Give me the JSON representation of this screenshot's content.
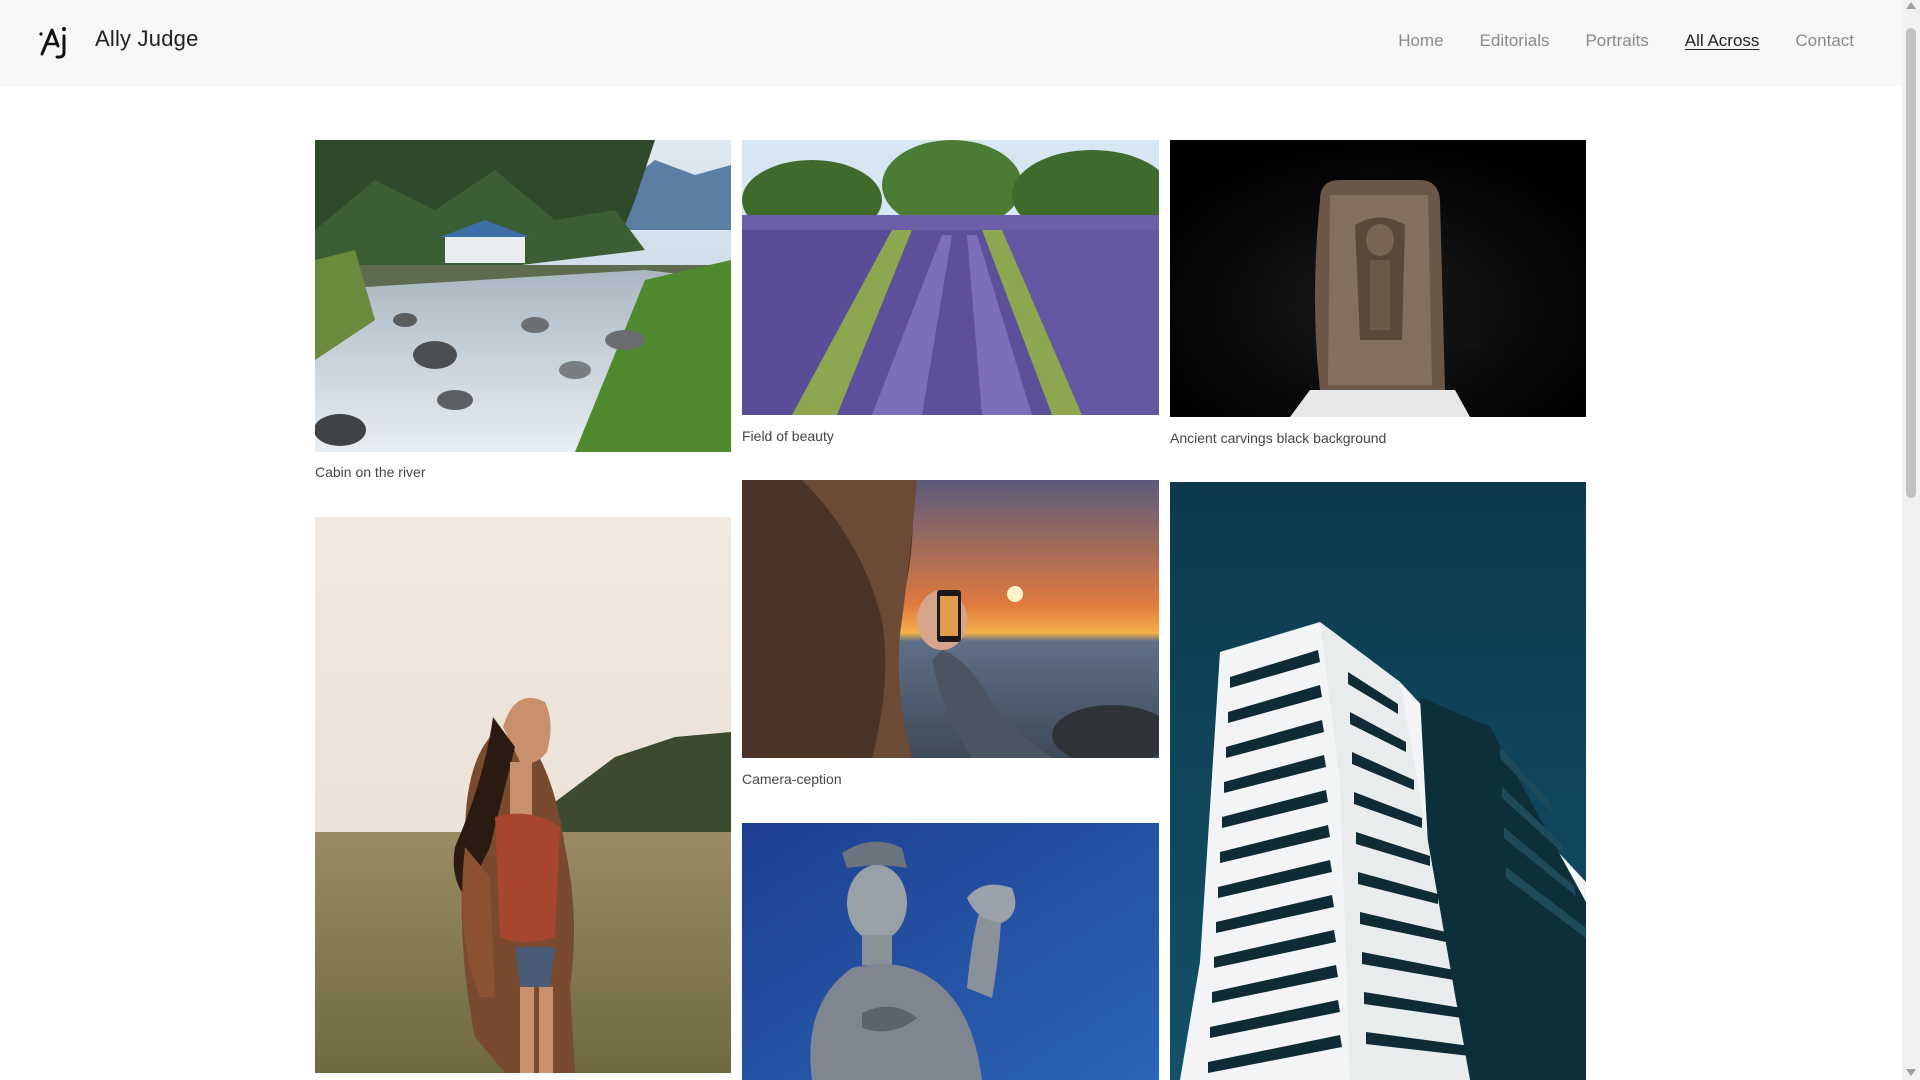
{
  "site": {
    "name": "Ally Judge",
    "logo_icon": "aj-monogram-icon"
  },
  "nav": {
    "items": [
      {
        "label": "Home",
        "active": false
      },
      {
        "label": "Editorials",
        "active": false
      },
      {
        "label": "Portraits",
        "active": false
      },
      {
        "label": "All Across",
        "active": true
      },
      {
        "label": "Contact",
        "active": false
      }
    ]
  },
  "gallery": {
    "items": [
      {
        "caption": "Cabin on the river"
      },
      {
        "caption": "Field of beauty"
      },
      {
        "caption": "Ancient carvings black background"
      },
      {
        "caption": ""
      },
      {
        "caption": "Camera-ception"
      },
      {
        "caption": ""
      },
      {
        "caption": ""
      }
    ]
  }
}
